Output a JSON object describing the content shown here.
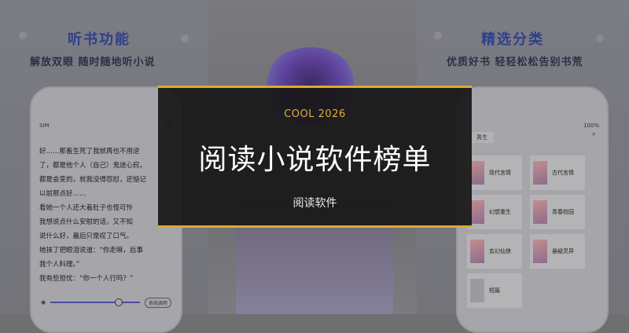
{
  "overlay": {
    "kicker": "COOL 2026",
    "title": "阅读小说软件榜单",
    "subtitle": "阅读软件"
  },
  "left_promo": {
    "title": "听书功能",
    "subtitle": "解放双眼 随时随地听小说",
    "status_left": "SIM",
    "reader_lines": [
      "好……那畜生死了我就再也不用逆",
      "了，都是他个人（自己）鬼迷心窍，",
      "都是会变的，就我没得怨怼，还惦记",
      "以前那点好……",
      "看她一个人还大着肚子也怪可怜",
      "我想说点什么安慰的话，又不知",
      "说什么好，最后只是叹了口气。",
      "她抹了把眼泪说道：“你走嘛，后事",
      "我个人料理。”",
      "我有些担忧：“你一个人行吗？”"
    ],
    "bottom_button": "系统调用"
  },
  "right_promo": {
    "title": "精选分类",
    "subtitle": "优质好书 轻轻松松告别书荒",
    "status_right": "100%",
    "tab": "男生",
    "categories": [
      "现代言情",
      "古代言情",
      "幻想重生",
      "青春校园",
      "玄幻仙侠",
      "悬疑灵异",
      "短篇"
    ]
  }
}
